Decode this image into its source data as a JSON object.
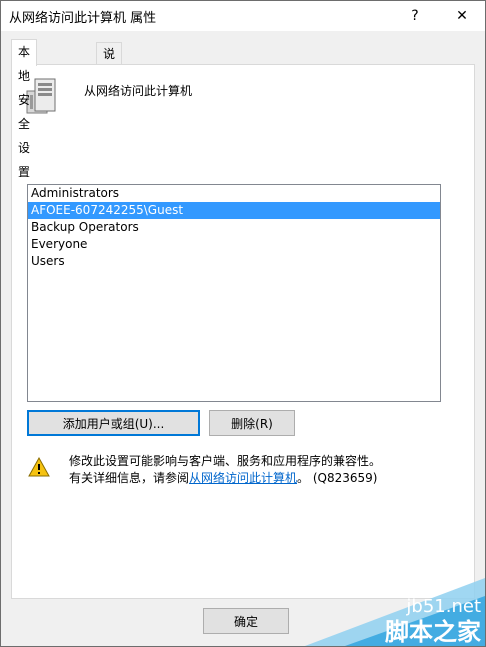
{
  "window": {
    "title": "从网络访问此计算机 属性"
  },
  "titlebar": {
    "help_glyph": "?",
    "close_glyph": "✕"
  },
  "tabs": [
    {
      "label": "本地安全设置",
      "active": true
    },
    {
      "label": "说明",
      "active": false
    }
  ],
  "policy": {
    "name": "从网络访问此计算机",
    "icon": "server-icon"
  },
  "members": [
    {
      "name": "Administrators",
      "selected": false
    },
    {
      "name": "AFOEE-607242255\\Guest",
      "selected": true
    },
    {
      "name": "Backup Operators",
      "selected": false
    },
    {
      "name": "Everyone",
      "selected": false
    },
    {
      "name": "Users",
      "selected": false
    }
  ],
  "buttons": {
    "add": "添加用户或组(U)...",
    "remove": "删除(R)",
    "ok": "确定"
  },
  "warning": {
    "icon": "warning-icon",
    "line1": "修改此设置可能影响与客户端、服务和应用程序的兼容性。",
    "line2_prefix": "有关详细信息，请参阅",
    "link": "从网络访问此计算机",
    "line2_suffix": "。 (Q823659)"
  },
  "watermark": {
    "site": "jb51.net",
    "name": "脚本之家"
  },
  "colors": {
    "selection": "#3399ff",
    "link": "#0066cc",
    "focus_border": "#0078d7"
  }
}
